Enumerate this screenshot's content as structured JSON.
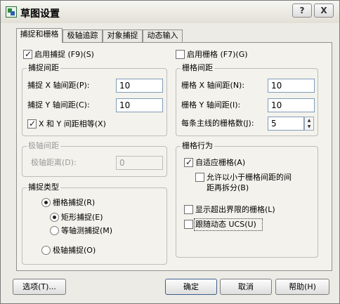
{
  "window": {
    "title": "草图设置",
    "help_label": "?",
    "close_label": "X"
  },
  "tabs": [
    {
      "label": "捕捉和栅格",
      "active": true
    },
    {
      "label": "极轴追踪",
      "active": false
    },
    {
      "label": "对象捕捉",
      "active": false
    },
    {
      "label": "动态输入",
      "active": false
    }
  ],
  "snap": {
    "enable_label": "启用捕捉 (F9)(S)",
    "enabled": true,
    "spacing_title": "捕捉间距",
    "x_label": "捕捉 X 轴间距(P):",
    "x_value": "10",
    "y_label": "捕捉 Y 轴间距(C):",
    "y_value": "10",
    "equal_label": "X 和 Y 间距相等(X)",
    "equal": true
  },
  "polar": {
    "title": "极轴间距",
    "distance_label": "极轴距离(D):",
    "distance_value": "0"
  },
  "snap_type": {
    "title": "捕捉类型",
    "grid_snap_label": "栅格捕捉(R)",
    "rect_label": "矩形捕捉(E)",
    "iso_label": "等轴测捕捉(M)",
    "polar_snap_label": "极轴捕捉(O)",
    "selected": "grid",
    "sub_selected": "rect"
  },
  "grid": {
    "enable_label": "启用栅格 (F7)(G)",
    "enabled": false,
    "spacing_title": "栅格间距",
    "x_label": "栅格 X 轴间距(N):",
    "x_value": "10",
    "y_label": "栅格 Y 轴间距(I):",
    "y_value": "10",
    "major_label": "每条主线的栅格数(J):",
    "major_value": "5"
  },
  "grid_behavior": {
    "title": "栅格行为",
    "adaptive_label": "自适应栅格(A)",
    "adaptive": true,
    "subdivide_label_1": "允许以小于栅格间距的间",
    "subdivide_label_2": "距再拆分(B)",
    "subdivide": false,
    "beyond_label": "显示超出界限的栅格(L)",
    "beyond": false,
    "follow_label": "跟随动态 UCS(U)",
    "follow": false
  },
  "footer": {
    "options_label": "选项(T)...",
    "ok_label": "确定",
    "cancel_label": "取消",
    "help_label": "帮助(H)"
  },
  "colors": {
    "panel": "#f3f2ec",
    "dialog": "#ecebe5",
    "disabled_text": "#9a9a9a"
  }
}
